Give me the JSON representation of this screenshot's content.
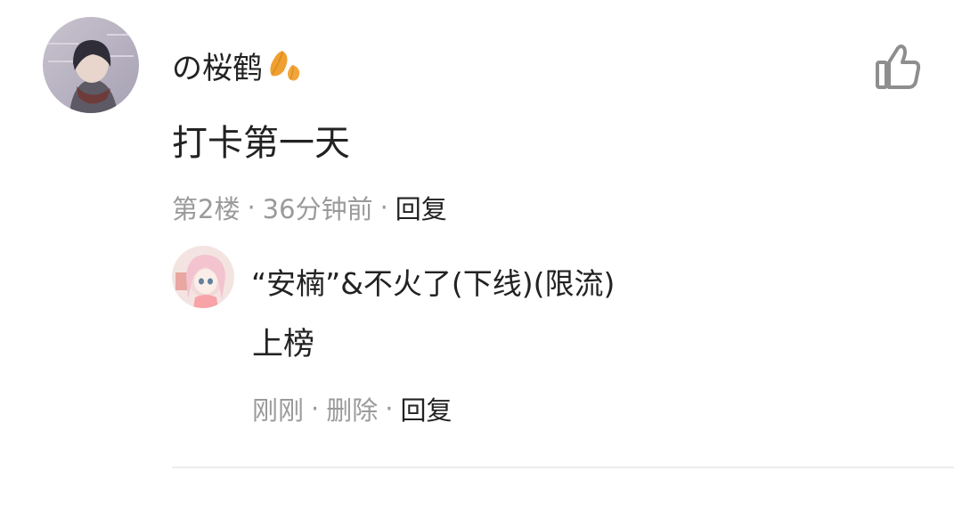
{
  "comment": {
    "username": "の桜鹤",
    "text": "打卡第一天",
    "floor": "第2楼",
    "time": "36分钟前",
    "reply_label": "回复",
    "separator": "·",
    "like_icon": "thumbs-up-icon",
    "badge_icon": "autumn-leaves-icon"
  },
  "reply": {
    "username": "“安楠”&不火了(下线)(限流)",
    "text": "上榜",
    "time": "刚刚",
    "delete_label": "删除",
    "reply_label": "回复",
    "separator": "·"
  },
  "colors": {
    "primary_text": "#222222",
    "secondary_text": "#9a9a9a",
    "divider": "#ececec",
    "leaf": "#f0a030"
  }
}
